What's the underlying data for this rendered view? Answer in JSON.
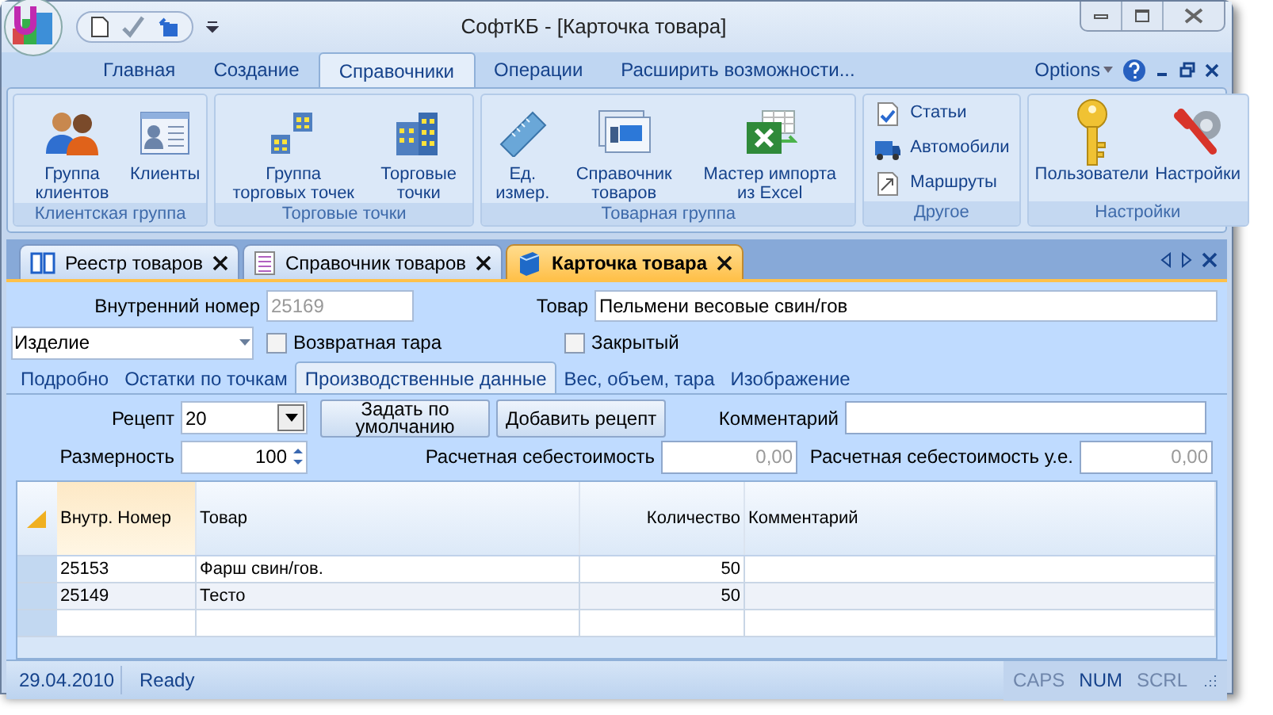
{
  "window": {
    "title": "СофтКБ - [Карточка товара]"
  },
  "ribbon_tabs": [
    {
      "label": "Главная",
      "selected": false
    },
    {
      "label": "Создание",
      "selected": false
    },
    {
      "label": "Справочники",
      "selected": true
    },
    {
      "label": "Операции",
      "selected": false
    },
    {
      "label": "Расширить возможности...",
      "selected": false
    }
  ],
  "options_menu": {
    "label": "Options"
  },
  "ribbon_groups": [
    {
      "label": "Клиентская группа",
      "items": [
        {
          "kind": "large",
          "label": "Группа клиентов"
        },
        {
          "kind": "large",
          "label": "Клиенты"
        }
      ]
    },
    {
      "label": "Торговые точки",
      "items": [
        {
          "kind": "large",
          "label": "Группа торговых точек"
        },
        {
          "kind": "large",
          "label": "Торговые точки"
        }
      ]
    },
    {
      "label": "Товарная группа",
      "items": [
        {
          "kind": "large",
          "label": "Ед. измер."
        },
        {
          "kind": "large",
          "label": "Справочник товаров"
        },
        {
          "kind": "large",
          "label": "Мастер импорта из Excel"
        }
      ]
    },
    {
      "label": "Другое",
      "items": [
        {
          "kind": "small",
          "label": "Статьи"
        },
        {
          "kind": "small",
          "label": "Автомобили"
        },
        {
          "kind": "small",
          "label": "Маршруты"
        }
      ]
    },
    {
      "label": "Настройки",
      "items": [
        {
          "kind": "large",
          "label": "Пользователи"
        },
        {
          "kind": "large",
          "label": "Настройки"
        }
      ]
    }
  ],
  "doc_tabs": [
    {
      "label": "Реестр товаров",
      "selected": false
    },
    {
      "label": "Справочник товаров",
      "selected": false
    },
    {
      "label": "Карточка товара",
      "selected": true
    }
  ],
  "form": {
    "internal_number": {
      "label": "Внутренний номер",
      "value": "25169",
      "disabled": true
    },
    "product": {
      "label": "Товар",
      "value": "Пельмени весовые свин/гов"
    },
    "type_select": {
      "value": "Изделие"
    },
    "returnable": {
      "label": "Возвратная тара",
      "checked": false
    },
    "closed": {
      "label": "Закрытый",
      "checked": false
    }
  },
  "sub_tabs": [
    {
      "label": "Подробно",
      "selected": false
    },
    {
      "label": "Остатки по точкам",
      "selected": false
    },
    {
      "label": "Производственные данные",
      "selected": true
    },
    {
      "label": "Вес, объем, тара",
      "selected": false
    },
    {
      "label": "Изображение",
      "selected": false
    }
  ],
  "production": {
    "recipe": {
      "label": "Рецепт",
      "value": "20"
    },
    "set_default_button": "Задать по умолчанию",
    "add_recipe_button": "Добавить рецепт",
    "comment": {
      "label": "Комментарий"
    },
    "size": {
      "label": "Размерность",
      "value": "100"
    },
    "cost": {
      "label": "Расчетная себестоимость",
      "value": "0,00",
      "disabled": true
    },
    "cost_ue": {
      "label": "Расчетная себестоимость у.е.",
      "value": "0,00",
      "disabled": true
    }
  },
  "table": {
    "columns": [
      {
        "label": "Внутр. Номер",
        "selected": true
      },
      {
        "label": "Товар",
        "selected": false
      },
      {
        "label": "Количество",
        "selected": false
      },
      {
        "label": "Комментарий",
        "selected": false
      }
    ],
    "rows": [
      [
        "25153",
        "Фарш свин/гов.",
        "50"
      ],
      [
        "25149",
        "Тесто",
        "50"
      ]
    ]
  },
  "status_bar": {
    "date": "29.04.2010",
    "state": "Ready",
    "indicators": [
      {
        "label": "CAPS",
        "on": false
      },
      {
        "label": "NUM",
        "on": true
      },
      {
        "label": "SCRL",
        "on": false
      }
    ]
  }
}
